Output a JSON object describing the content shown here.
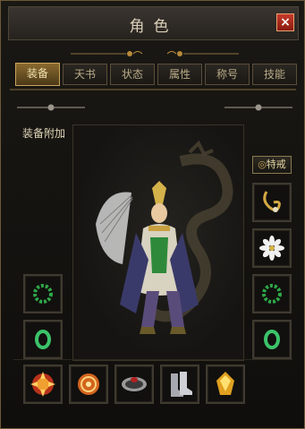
{
  "window": {
    "title": "角色",
    "close_glyph": "×"
  },
  "tabs": [
    {
      "label": "装备",
      "active": true
    },
    {
      "label": "天书",
      "active": false
    },
    {
      "label": "状态",
      "active": false
    },
    {
      "label": "属性",
      "active": false
    },
    {
      "label": "称号",
      "active": false
    },
    {
      "label": "技能",
      "active": false
    }
  ],
  "equipment": {
    "section_label": "装备附加",
    "special_button": "特戒",
    "left_slots": [
      "green-bead-bracelet-icon",
      "jade-ring-icon"
    ],
    "right_slots": [
      "golden-necklace-icon",
      "white-flower-medal-icon",
      "green-bead-bracelet-icon",
      "jade-ring-icon"
    ],
    "bottom_slots": [
      "fire-medal-icon",
      "fire-orb-icon",
      "silver-belt-icon",
      "steel-boots-icon",
      "golden-gem-icon"
    ]
  },
  "colors": {
    "accent_gold": "#c8a45c",
    "close_red": "#b02a1c",
    "text": "#e0d6b8"
  }
}
